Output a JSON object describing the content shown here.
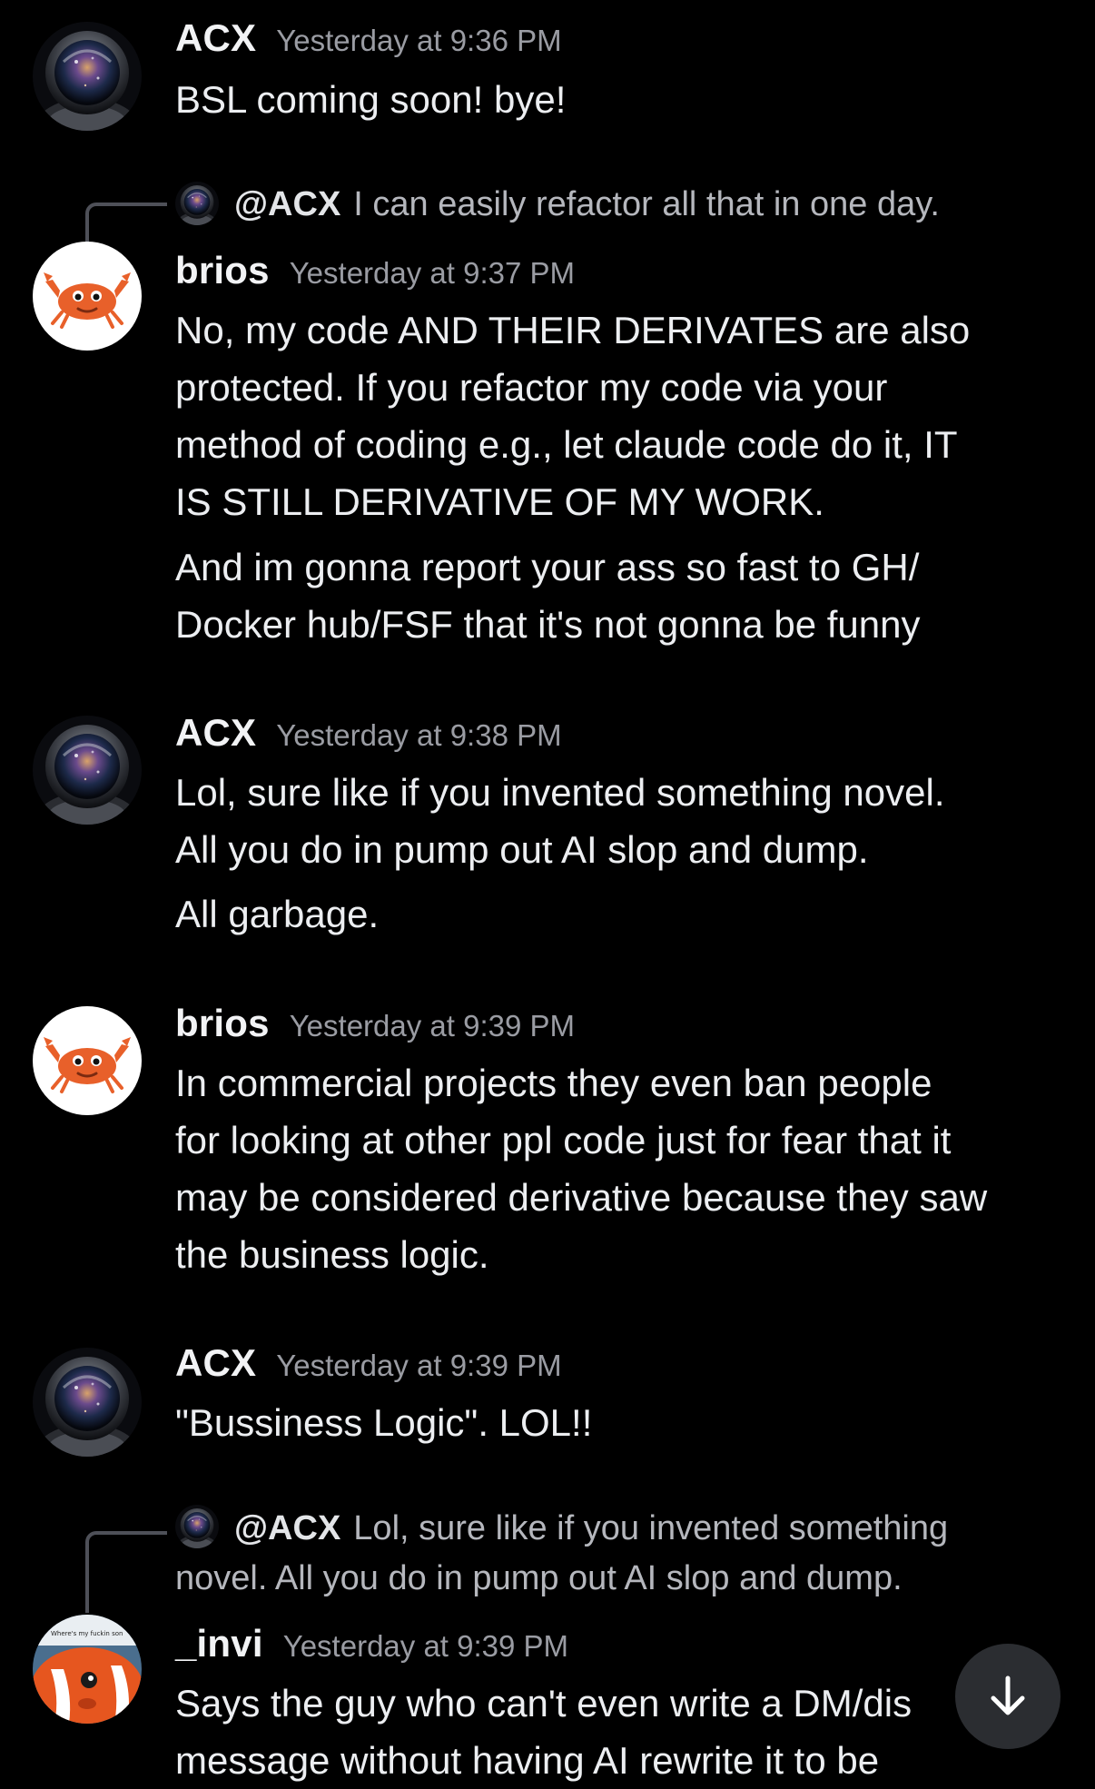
{
  "colors": {
    "background": "#000000",
    "username": "#f2f3f5",
    "timestamp": "#9a9ca3",
    "message_text": "#eceef1",
    "reply_text": "#b5b7bd",
    "reply_line": "#4e5058",
    "jump_button": "#2b2d31"
  },
  "messages": [
    {
      "author": "ACX",
      "time": "Yesterday at 9:36 PM",
      "avatar_icon": "astronaut-avatar-icon",
      "lines": [
        "BSL coming soon! bye!"
      ]
    },
    {
      "reply": {
        "author": "@ACX",
        "text": "I can easily refactor all that in one day."
      },
      "author": "brios",
      "time": "Yesterday at 9:37 PM",
      "avatar_icon": "crab-avatar-icon",
      "lines": [
        "No, my code AND THEIR DERIVATES are also",
        "protected. If you refactor my code via your",
        "method of coding e.g., let claude code do it, IT",
        "IS STILL DERIVATIVE OF MY WORK.",
        "And im gonna report your ass so fast to GH/",
        "Docker hub/FSF that it's not gonna be funny"
      ]
    },
    {
      "author": "ACX",
      "time": "Yesterday at 9:38 PM",
      "avatar_icon": "astronaut-avatar-icon",
      "lines": [
        "Lol, sure like if you invented something novel.",
        "All you do in pump out AI slop and dump.",
        "All garbage."
      ]
    },
    {
      "author": "brios",
      "time": "Yesterday at 9:39 PM",
      "avatar_icon": "crab-avatar-icon",
      "lines": [
        "In commercial projects they even ban people",
        "for looking at other ppl code just for fear that it",
        "may be considered derivative because they saw",
        "the business logic."
      ]
    },
    {
      "author": "ACX",
      "time": "Yesterday at 9:39 PM",
      "avatar_icon": "astronaut-avatar-icon",
      "lines": [
        "\"Bussiness Logic\". LOL!!"
      ]
    },
    {
      "reply": {
        "author": "@ACX",
        "text": "Lol, sure like if you invented something",
        "text2": "novel. All you do in pump out AI slop and dump."
      },
      "author": "_invi",
      "time": "Yesterday at 9:39 PM",
      "avatar_icon": "clownfish-avatar-icon",
      "avatar_caption": "Where's my fuckin son",
      "lines": [
        "Says the guy who can't even write a DM/dis",
        "message without having AI rewrite it to be"
      ]
    }
  ],
  "jump_to_present": {
    "icon": "arrow-down-icon"
  }
}
